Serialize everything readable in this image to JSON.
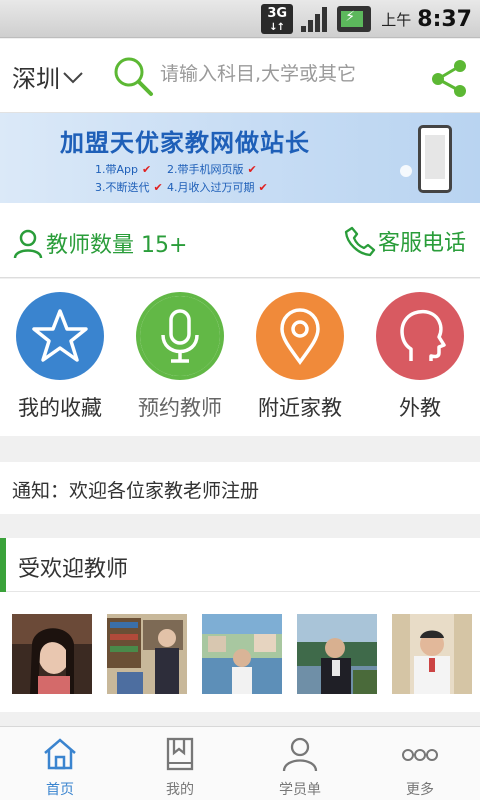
{
  "status_bar": {
    "network": "3G",
    "ampm": "上午",
    "time": "8:37"
  },
  "header": {
    "city": "深圳",
    "search_placeholder": "请输入科目,大学或其它"
  },
  "banner": {
    "title": "加盟天优家教网做站长",
    "lines": [
      "1.带App",
      "2.带手机网页版",
      "3.不断迭代",
      "4.月收入过万可期"
    ],
    "tick": "✔"
  },
  "info": {
    "teacher_count": "教师数量 15+",
    "service": "客服电话"
  },
  "actions": [
    {
      "label": "我的收藏",
      "color": "#3a84cf",
      "icon": "star-icon"
    },
    {
      "label": "预约教师",
      "color": "#62b846",
      "icon": "microphone-icon"
    },
    {
      "label": "附近家教",
      "color": "#f08a3a",
      "icon": "location-pin-icon"
    },
    {
      "label": "外教",
      "color": "#d85a61",
      "icon": "head-profile-icon"
    }
  ],
  "notice": "通知：欢迎各位家教老师注册",
  "popular": {
    "title": "受欢迎教师"
  },
  "bottom_nav": [
    {
      "label": "首页",
      "icon": "home-icon",
      "active": true
    },
    {
      "label": "我的",
      "icon": "bookmark-book-icon",
      "active": false
    },
    {
      "label": "学员单",
      "icon": "person-icon",
      "active": false
    },
    {
      "label": "更多",
      "icon": "more-dots-icon",
      "active": false
    }
  ],
  "colors": {
    "accent_green": "#2a9d3a",
    "nav_active": "#3a84cf",
    "brand_blue": "#1e5fb8"
  }
}
